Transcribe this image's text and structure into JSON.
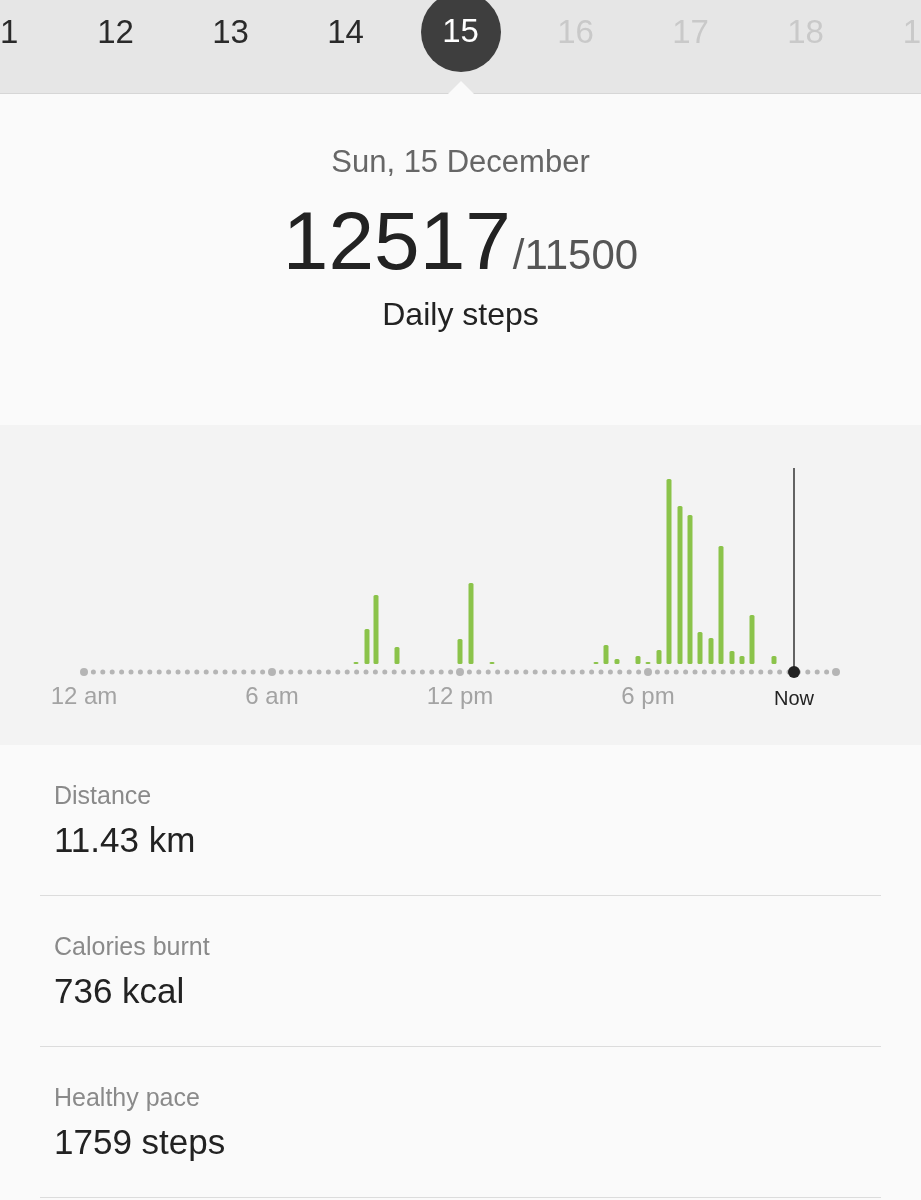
{
  "date_strip": {
    "days": [
      {
        "label": "1",
        "selected": false,
        "disabled": false
      },
      {
        "label": "12",
        "selected": false,
        "disabled": false
      },
      {
        "label": "13",
        "selected": false,
        "disabled": false
      },
      {
        "label": "14",
        "selected": false,
        "disabled": false
      },
      {
        "label": "15",
        "selected": true,
        "disabled": false
      },
      {
        "label": "16",
        "selected": false,
        "disabled": true
      },
      {
        "label": "17",
        "selected": false,
        "disabled": true
      },
      {
        "label": "18",
        "selected": false,
        "disabled": true
      },
      {
        "label": "1",
        "selected": false,
        "disabled": true
      }
    ]
  },
  "summary": {
    "date": "Sun, 15 December",
    "steps": "12517",
    "goal": "/11500",
    "caption": "Daily steps"
  },
  "chart": {
    "axis_labels": [
      "12 am",
      "6 am",
      "12 pm",
      "6 pm"
    ],
    "now_label": "Now"
  },
  "stats": [
    {
      "label": "Distance",
      "value": "11.43 km"
    },
    {
      "label": "Calories burnt",
      "value": "736 kcal"
    },
    {
      "label": "Healthy pace",
      "value": "1759 steps"
    }
  ]
}
